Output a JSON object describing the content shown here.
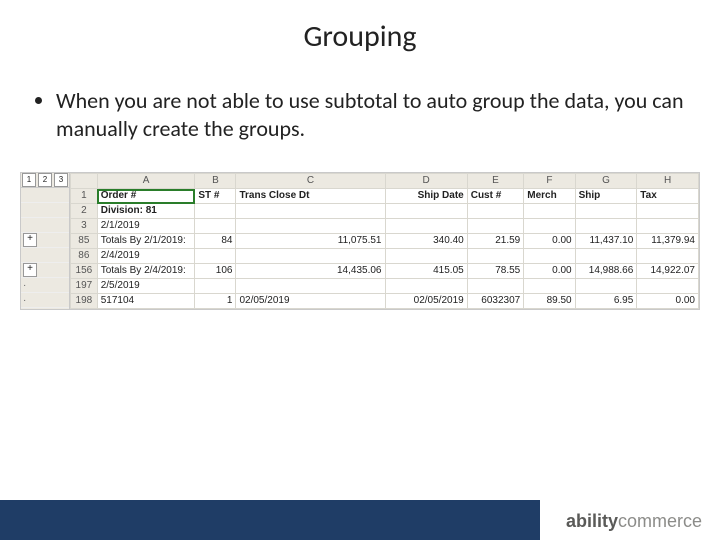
{
  "title": "Grouping",
  "bullet": "When you are not able to use subtotal to auto group the data, you can manually create the groups.",
  "sheet": {
    "outlineLevels": [
      "1",
      "2",
      "3"
    ],
    "columns": [
      "A",
      "B",
      "C",
      "D",
      "E",
      "F",
      "G",
      "H"
    ],
    "headerRow": {
      "num": "1",
      "A": "Order #",
      "B": "ST #",
      "C": "Trans Close Dt",
      "D": "Ship Date",
      "E": "Cust #",
      "F": "Merch",
      "G": "Ship",
      "H": "Tax"
    },
    "rows": [
      {
        "num": "2",
        "outline": "",
        "A": "Division: 81"
      },
      {
        "num": "3",
        "outline": "",
        "A": "2/1/2019"
      },
      {
        "num": "85",
        "outline": "+",
        "A": "Totals By 2/1/2019:",
        "B": "84",
        "C": "11,075.51",
        "D": "340.40",
        "E": "21.59",
        "F": "0.00",
        "G": "11,437.10",
        "H": "11,379.94"
      },
      {
        "num": "86",
        "outline": "",
        "A": "2/4/2019"
      },
      {
        "num": "156",
        "outline": "+",
        "A": "Totals By 2/4/2019:",
        "B": "106",
        "C": "14,435.06",
        "D": "415.05",
        "E": "78.55",
        "F": "0.00",
        "G": "14,988.66",
        "H": "14,922.07"
      },
      {
        "num": "197",
        "outline": "tick",
        "A": "2/5/2019"
      },
      {
        "num": "198",
        "outline": "tick",
        "A": "517104",
        "B": "1",
        "C": "02/05/2019",
        "D": "02/05/2019",
        "E": "6032307",
        "F": "89.50",
        "G": "6.95",
        "H": "0.00"
      }
    ]
  },
  "logo": {
    "part1": "ability",
    "part2": "commerce"
  }
}
